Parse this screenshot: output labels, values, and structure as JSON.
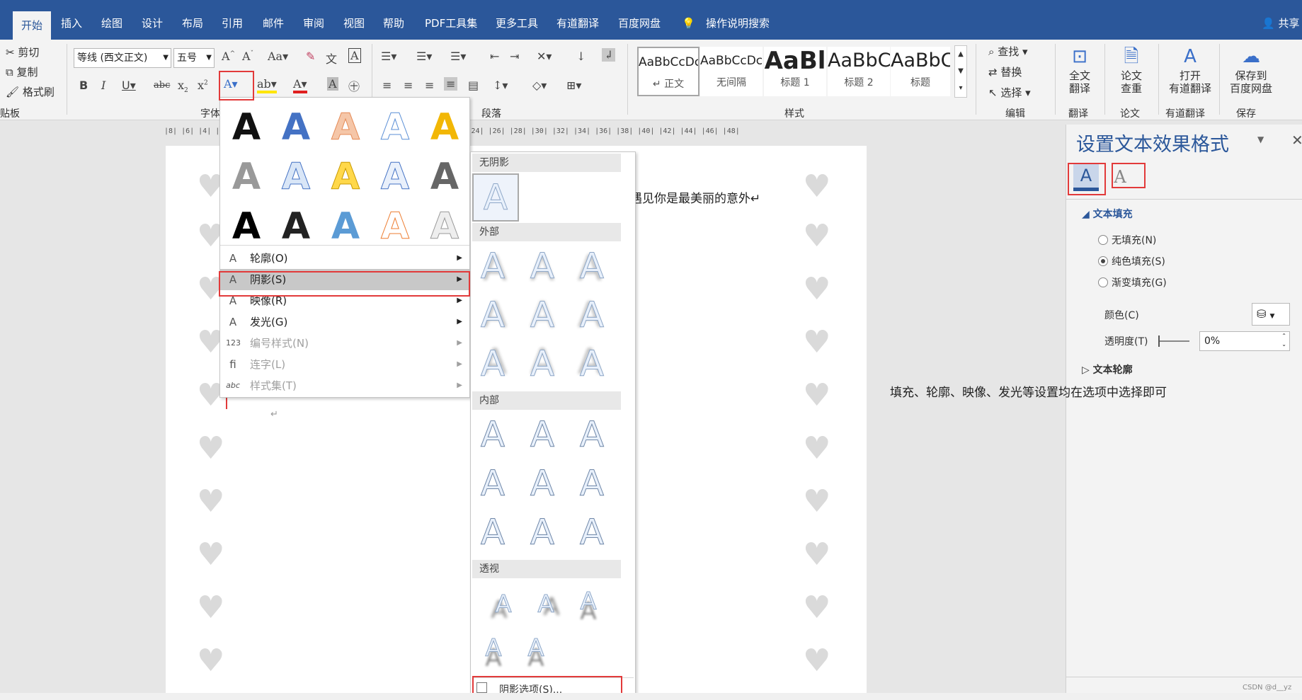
{
  "tabs": [
    "开始",
    "插入",
    "绘图",
    "设计",
    "布局",
    "引用",
    "邮件",
    "审阅",
    "视图",
    "帮助",
    "PDF工具集",
    "更多工具",
    "有道翻译",
    "百度网盘"
  ],
  "active_tab": "开始",
  "tell_me": "操作说明搜索",
  "share": "共享",
  "clipboard": {
    "cut": "剪切",
    "copy": "复制",
    "format_painter": "格式刷",
    "group": "贴板"
  },
  "font": {
    "name": "等线 (西文正文)",
    "size": "五号",
    "group": "字体"
  },
  "paragraph_group": "段落",
  "styles": {
    "items": [
      {
        "preview": "AaBbCcDc",
        "label": "↵ 正文"
      },
      {
        "preview": "AaBbCcDc",
        "label": "无间隔"
      },
      {
        "preview": "AaBl",
        "label": "标题 1"
      },
      {
        "preview": "AaBbC",
        "label": "标题 2"
      },
      {
        "preview": "AaBbC",
        "label": "标题"
      }
    ],
    "group": "样式"
  },
  "editing": {
    "find": "查找",
    "replace": "替换",
    "select": "选择",
    "group": "编辑"
  },
  "addins": [
    {
      "line1": "全文",
      "line2": "翻译",
      "group": "翻译"
    },
    {
      "line1": "论文",
      "line2": "查重",
      "group": "论文"
    },
    {
      "line1": "打开",
      "line2": "有道翻译",
      "group": "有道翻译"
    },
    {
      "line1": "保存到",
      "line2": "百度网盘",
      "group": "保存"
    }
  ],
  "ruler": "|8|  |6|  |4|  |2|  | |  |2|  |4|  |6|  |8|  |10|  |12|  |14|  |16| |18| |20| |22| |24| |26| |28| |30| |32| |34| |36| |38| |40| |42| |44| |46| |48|",
  "document_text": "遇见你是最美丽的意外↵",
  "effects_menu": {
    "items": [
      {
        "label": "轮廓(O)",
        "icon": "A",
        "disabled": false
      },
      {
        "label": "阴影(S)",
        "icon": "A",
        "disabled": false
      },
      {
        "label": "映像(R)",
        "icon": "A",
        "disabled": false
      },
      {
        "label": "发光(G)",
        "icon": "A",
        "disabled": false
      },
      {
        "label": "编号样式(N)",
        "icon": "123",
        "disabled": true
      },
      {
        "label": "连字(L)",
        "icon": "fi",
        "disabled": true
      },
      {
        "label": "样式集(T)",
        "icon": "abc",
        "disabled": true
      }
    ]
  },
  "shadow_menu": {
    "no_shadow": "无阴影",
    "outer": "外部",
    "inner": "内部",
    "perspective": "透视",
    "options": "阴影选项(S)..."
  },
  "side_panel": {
    "title": "设置文本效果格式",
    "text_fill": "文本填充",
    "no_fill": "无填充(N)",
    "solid_fill": "纯色填充(S)",
    "gradient_fill": "渐变填充(G)",
    "color": "颜色(C)",
    "transparency": "透明度(T)",
    "transparency_value": "0%",
    "text_outline": "文本轮廓"
  },
  "annotation": "填充、轮廓、映像、发光等设置均在选项中选择即可",
  "watermark": "CSDN @d__yz",
  "colors": {
    "ribbon_blue": "#2b579a",
    "highlight_red": "#e23a3a",
    "menu_selected": "#c8c8c8"
  }
}
